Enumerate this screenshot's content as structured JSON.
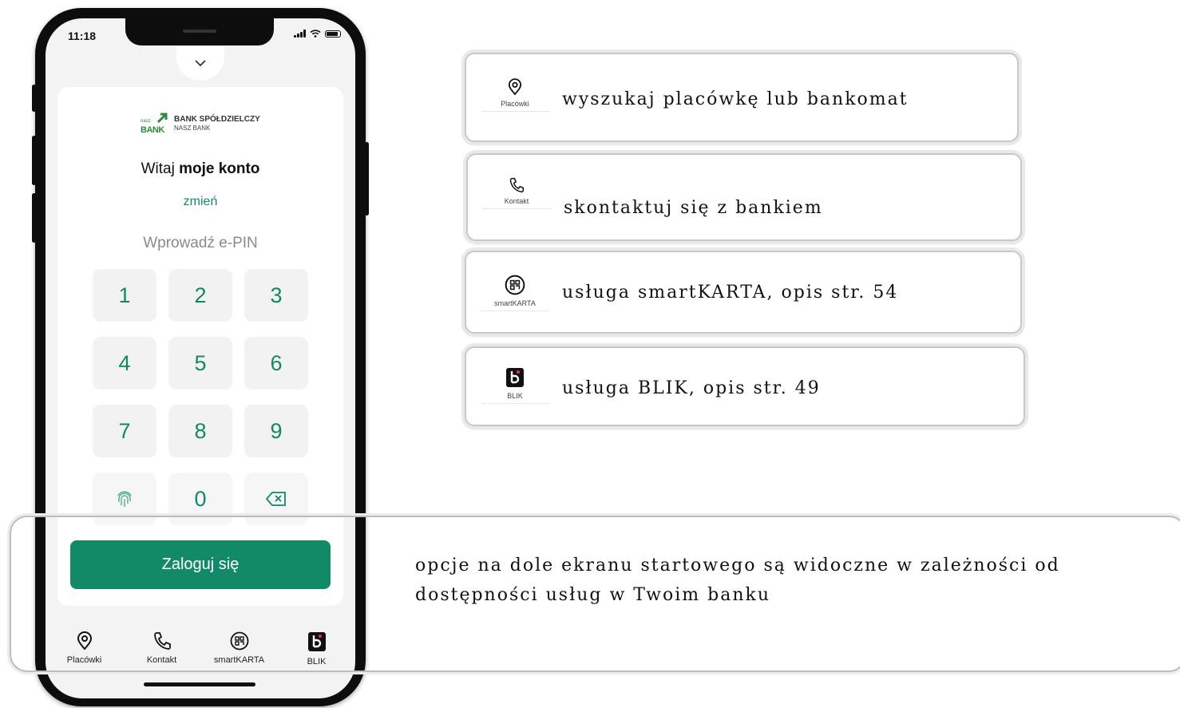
{
  "phone": {
    "status_time": "11:18",
    "logo": {
      "small": "nasz",
      "brand": "BANK",
      "line1": "BANK SPÓŁDZIELCZY",
      "line2": "NASZ BANK"
    },
    "welcome_regular": "Witaj ",
    "welcome_bold": "moje konto",
    "change_link": "zmień",
    "pin_prompt": "Wprowadź e-PIN",
    "keys": [
      "1",
      "2",
      "3",
      "4",
      "5",
      "6",
      "7",
      "8",
      "9",
      "0"
    ],
    "login_button": "Zaloguj się",
    "nav": [
      {
        "label": "Placówki",
        "icon": "location-pin-icon"
      },
      {
        "label": "Kontakt",
        "icon": "phone-icon"
      },
      {
        "label": "smartKARTA",
        "icon": "smartkarta-icon"
      },
      {
        "label": "BLIK",
        "icon": "blik-icon"
      }
    ],
    "accent_color": "#138a67"
  },
  "callouts": [
    {
      "icon_label": "Placówki",
      "text": "wyszukaj placówkę lub bankomat"
    },
    {
      "icon_label": "Kontakt",
      "text": "skontaktuj się z bankiem"
    },
    {
      "icon_label": "smartKARTA",
      "text": "usługa smartKARTA, opis str. 54"
    },
    {
      "icon_label": "BLIK",
      "text": "usługa BLIK, opis str. 49"
    }
  ],
  "bottom_note": "opcje na dole ekranu startowego są widoczne w zależności od dostępności usług w Twoim banku"
}
